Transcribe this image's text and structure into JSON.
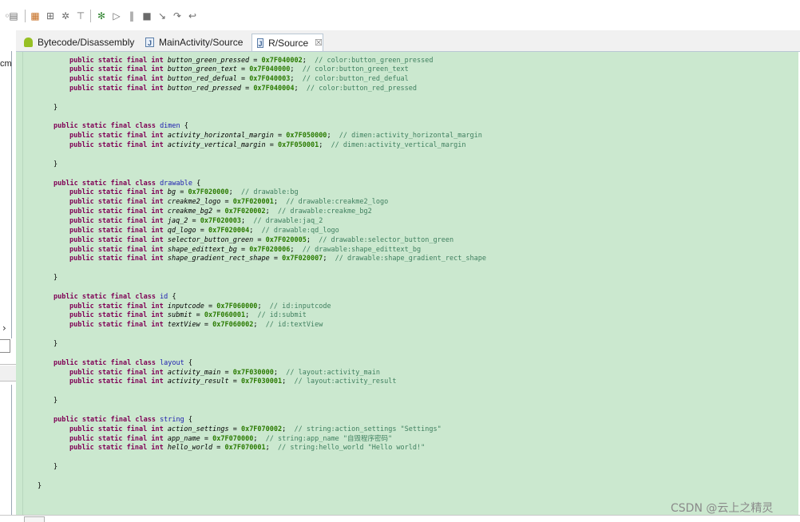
{
  "toolbar": {
    "icons": [
      "nav-back-icon",
      "open-file-icon",
      "grid-view-icon",
      "hierarchy-icon",
      "bug-icon",
      "type-hierarchy-icon",
      "debug-icon",
      "resume-icon",
      "suspend-icon",
      "stop-icon",
      "step-into-icon",
      "step-over-icon",
      "step-return-icon"
    ]
  },
  "left_panel": {
    "clipped_text": "cm",
    "expand_arrow": "›"
  },
  "tabs": [
    {
      "label": "Bytecode/Disassembly",
      "active": false
    },
    {
      "label": "MainActivity/Source",
      "active": false
    },
    {
      "label": "R/Source",
      "active": true,
      "close": "☒"
    }
  ],
  "code": {
    "color_fields": [
      {
        "name": "button_green_pressed",
        "value": "0x7F040002",
        "comment": "// color:button_green_pressed"
      },
      {
        "name": "button_green_text",
        "value": "0x7F040000",
        "comment": "// color:button_green_text"
      },
      {
        "name": "button_red_defual",
        "value": "0x7F040003",
        "comment": "// color:button_red_defual"
      },
      {
        "name": "button_red_pressed",
        "value": "0x7F040004",
        "comment": "// color:button_red_pressed"
      }
    ],
    "sections": [
      {
        "class": "dimen",
        "fields": [
          {
            "name": "activity_horizontal_margin",
            "value": "0x7F050000",
            "comment": "// dimen:activity_horizontal_margin"
          },
          {
            "name": "activity_vertical_margin",
            "value": "0x7F050001",
            "comment": "// dimen:activity_vertical_margin"
          }
        ]
      },
      {
        "class": "drawable",
        "fields": [
          {
            "name": "bg",
            "value": "0x7F020000",
            "comment": "// drawable:bg"
          },
          {
            "name": "creakme2_logo",
            "value": "0x7F020001",
            "comment": "// drawable:creakme2_logo"
          },
          {
            "name": "creakme_bg2",
            "value": "0x7F020002",
            "comment": "// drawable:creakme_bg2"
          },
          {
            "name": "jaq_2",
            "value": "0x7F020003",
            "comment": "// drawable:jaq_2"
          },
          {
            "name": "qd_logo",
            "value": "0x7F020004",
            "comment": "// drawable:qd_logo"
          },
          {
            "name": "selector_button_green",
            "value": "0x7F020005",
            "comment": "// drawable:selector_button_green"
          },
          {
            "name": "shape_edittext_bg",
            "value": "0x7F020006",
            "comment": "// drawable:shape_edittext_bg"
          },
          {
            "name": "shape_gradient_rect_shape",
            "value": "0x7F020007",
            "comment": "// drawable:shape_gradient_rect_shape"
          }
        ]
      },
      {
        "class": "id",
        "fields": [
          {
            "name": "inputcode",
            "value": "0x7F060000",
            "comment": "// id:inputcode"
          },
          {
            "name": "submit",
            "value": "0x7F060001",
            "comment": "// id:submit"
          },
          {
            "name": "textView",
            "value": "0x7F060002",
            "comment": "// id:textView"
          }
        ]
      },
      {
        "class": "layout",
        "fields": [
          {
            "name": "activity_main",
            "value": "0x7F030000",
            "comment": "// layout:activity_main"
          },
          {
            "name": "activity_result",
            "value": "0x7F030001",
            "comment": "// layout:activity_result"
          }
        ]
      },
      {
        "class": "string",
        "fields": [
          {
            "name": "action_settings",
            "value": "0x7F070002",
            "comment": "// string:action_settings \"Settings\""
          },
          {
            "name": "app_name",
            "value": "0x7F070000",
            "comment": "// string:app_name \"自毁程序密码\""
          },
          {
            "name": "hello_world",
            "value": "0x7F070001",
            "comment": "// string:hello_world \"Hello world!\""
          }
        ]
      }
    ],
    "field_prefix": "public static final int ",
    "class_prefix": "public static final class ",
    "open_brace": "{",
    "close_brace": "}"
  },
  "watermark": "CSDN @云上之精灵"
}
